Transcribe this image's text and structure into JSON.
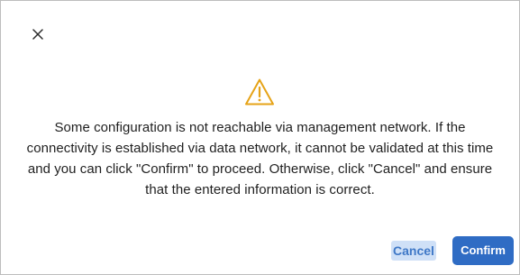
{
  "dialog": {
    "close_icon": "close-icon",
    "warning_icon": "warning-icon",
    "message": "Some configuration is not reachable via management network. If the connectivity is established via data network, it cannot be validated at this time and you can click \"Confirm\" to proceed. Otherwise, click \"Cancel\" and ensure that the entered information is correct.",
    "buttons": {
      "cancel_label": "Cancel",
      "confirm_label": "Confirm"
    }
  },
  "colors": {
    "warning": "#e6a317",
    "primary": "#2f6cc4",
    "cancel_text": "#3f78c7",
    "cancel_bg": "#cfe0f7"
  }
}
